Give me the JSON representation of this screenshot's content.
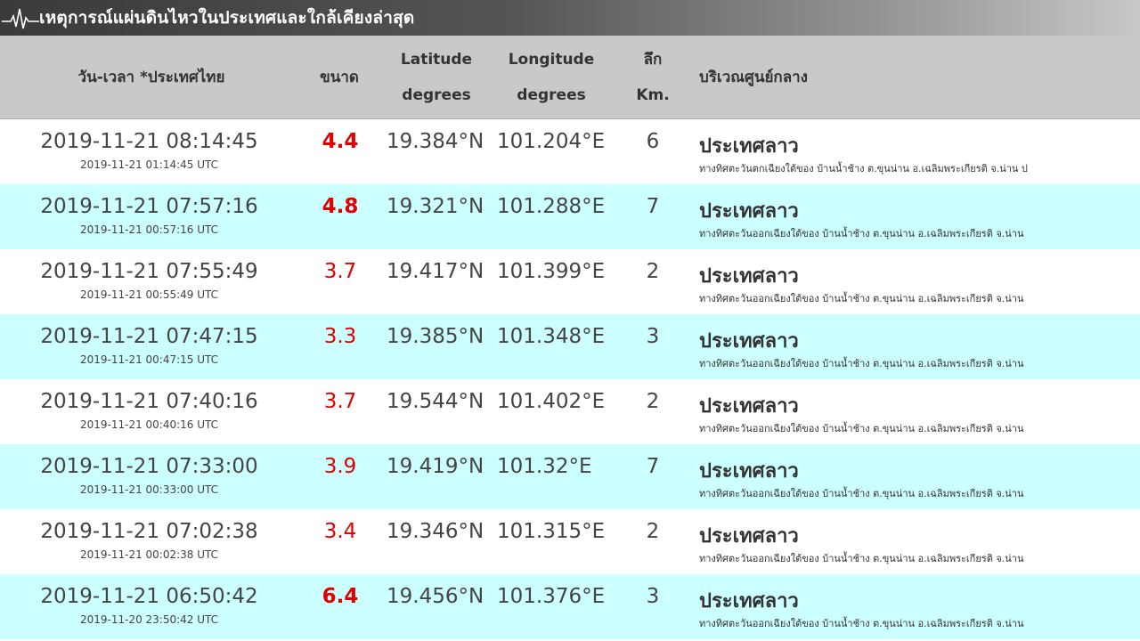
{
  "title": "เหตุการณ์แผ่นดินไหวในประเทศและใกล้เคียงล่าสุด",
  "headers": {
    "datetime": "วัน-เวลา *ประเทศไทย",
    "magnitude": "ขนาด",
    "latitude_1": "Latitude",
    "latitude_2": "degrees",
    "longitude_1": "Longitude",
    "longitude_2": "degrees",
    "depth_1": "ลึก",
    "depth_2": "Km.",
    "region": "บริเวณศูนย์กลาง"
  },
  "colors": {
    "alt_row": "#ccffff",
    "header_bg": "#c9c9c9",
    "magnitude": "#e00000"
  },
  "rows": [
    {
      "local": "2019-11-21 08:14:45",
      "utc": "2019-11-21 01:14:45 UTC",
      "mag": "4.4",
      "lat": "19.384°N",
      "lon": "101.204°E",
      "depth": "6",
      "region": "ประเทศลาว",
      "detail": "ทางทิศตะวันตกเฉียงใต้ของ บ้านน้ำช้าง ต.ขุนน่าน อ.เฉลิมพระเกียรติ จ.น่าน ป"
    },
    {
      "local": "2019-11-21 07:57:16",
      "utc": "2019-11-21 00:57:16 UTC",
      "mag": "4.8",
      "lat": "19.321°N",
      "lon": "101.288°E",
      "depth": "7",
      "region": "ประเทศลาว",
      "detail": "ทางทิศตะวันออกเฉียงใต้ของ บ้านน้ำช้าง ต.ขุนน่าน อ.เฉลิมพระเกียรติ จ.น่าน"
    },
    {
      "local": "2019-11-21 07:55:49",
      "utc": "2019-11-21 00:55:49 UTC",
      "mag": "3.7",
      "lat": "19.417°N",
      "lon": "101.399°E",
      "depth": "2",
      "region": "ประเทศลาว",
      "detail": "ทางทิศตะวันออกเฉียงใต้ของ บ้านน้ำช้าง ต.ขุนน่าน อ.เฉลิมพระเกียรติ จ.น่าน"
    },
    {
      "local": "2019-11-21 07:47:15",
      "utc": "2019-11-21 00:47:15 UTC",
      "mag": "3.3",
      "lat": "19.385°N",
      "lon": "101.348°E",
      "depth": "3",
      "region": "ประเทศลาว",
      "detail": "ทางทิศตะวันออกเฉียงใต้ของ บ้านน้ำช้าง ต.ขุนน่าน อ.เฉลิมพระเกียรติ จ.น่าน"
    },
    {
      "local": "2019-11-21 07:40:16",
      "utc": "2019-11-21 00:40:16 UTC",
      "mag": "3.7",
      "lat": "19.544°N",
      "lon": "101.402°E",
      "depth": "2",
      "region": "ประเทศลาว",
      "detail": "ทางทิศตะวันออกเฉียงใต้ของ บ้านน้ำช้าง ต.ขุนน่าน อ.เฉลิมพระเกียรติ จ.น่าน"
    },
    {
      "local": "2019-11-21 07:33:00",
      "utc": "2019-11-21 00:33:00 UTC",
      "mag": "3.9",
      "lat": "19.419°N",
      "lon": "101.32°E",
      "depth": "7",
      "region": "ประเทศลาว",
      "detail": "ทางทิศตะวันออกเฉียงใต้ของ บ้านน้ำช้าง ต.ขุนน่าน อ.เฉลิมพระเกียรติ จ.น่าน"
    },
    {
      "local": "2019-11-21 07:02:38",
      "utc": "2019-11-21 00:02:38 UTC",
      "mag": "3.4",
      "lat": "19.346°N",
      "lon": "101.315°E",
      "depth": "2",
      "region": "ประเทศลาว",
      "detail": "ทางทิศตะวันออกเฉียงใต้ของ บ้านน้ำช้าง ต.ขุนน่าน อ.เฉลิมพระเกียรติ จ.น่าน"
    },
    {
      "local": "2019-11-21 06:50:42",
      "utc": "2019-11-20 23:50:42 UTC",
      "mag": "6.4",
      "lat": "19.456°N",
      "lon": "101.376°E",
      "depth": "3",
      "region": "ประเทศลาว",
      "detail": "ทางทิศตะวันออกเฉียงใต้ของ บ้านน้ำช้าง ต.ขุนน่าน อ.เฉลิมพระเกียรติ จ.น่าน"
    }
  ]
}
